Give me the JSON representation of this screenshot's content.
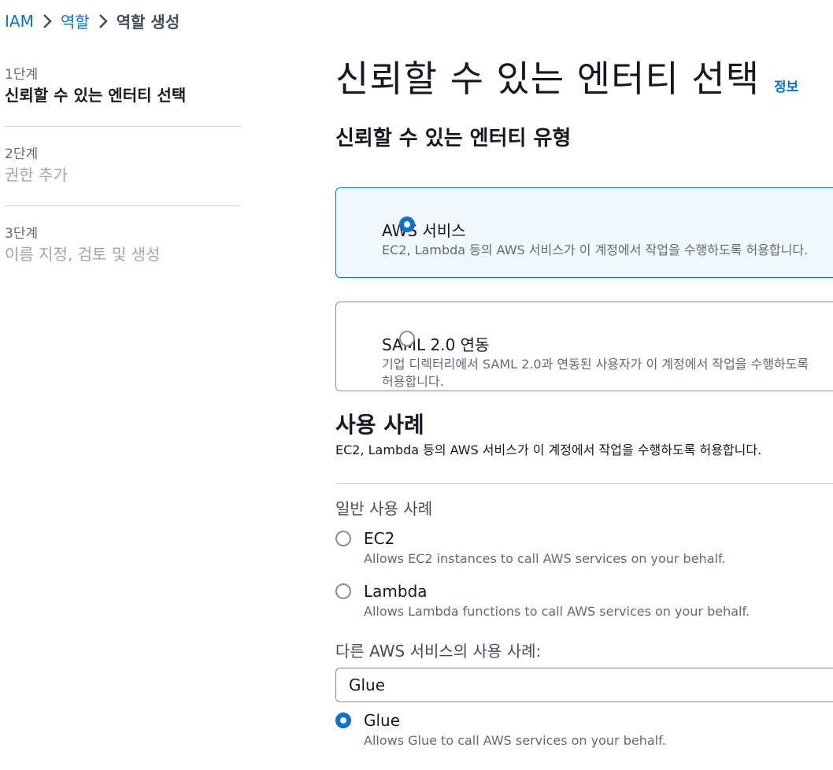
{
  "breadcrumb": {
    "items": [
      "IAM",
      "역할"
    ],
    "current": "역할 생성"
  },
  "steps": [
    {
      "num": "1단계",
      "title": "신뢰할 수 있는 엔터티 선택"
    },
    {
      "num": "2단계",
      "title": "권한 추가"
    },
    {
      "num": "3단계",
      "title": "이름 지정, 검토 및 생성"
    }
  ],
  "main": {
    "title": "신뢰할 수 있는 엔터티 선택",
    "info": "정보",
    "entity_type_title": "신뢰할 수 있는 엔터티 유형"
  },
  "tiles": [
    {
      "title": "AWS 서비스",
      "desc": "EC2, Lambda 등의 AWS 서비스가 이 계정에서 작업을 수행하도록 허용합니다."
    },
    {
      "title": "SAML 2.0 연동",
      "desc1": "기업 디렉터리에서 SAML 2.0과 연동된 사용자가 이 계정에서 작업을 수행하도록",
      "desc2": "허용합니다."
    }
  ],
  "usecase": {
    "title": "사용 사례",
    "desc": "EC2, Lambda 등의 AWS 서비스가 이 계정에서 작업을 수행하도록 허용합니다.",
    "common_label": "일반 사용 사례",
    "options": [
      {
        "title": "EC2",
        "desc": "Allows EC2 instances to call AWS services on your behalf."
      },
      {
        "title": "Lambda",
        "desc": "Allows Lambda functions to call AWS services on your behalf."
      }
    ],
    "other_label": "다른 AWS 서비스의 사용 사례:",
    "selected_service": "Glue",
    "selected_option": {
      "title": "Glue",
      "desc": "Allows Glue to call AWS services on your behalf."
    }
  },
  "colors": {
    "accent": "#0972d3",
    "text": "#16191f",
    "muted": "#5f6b7a"
  }
}
